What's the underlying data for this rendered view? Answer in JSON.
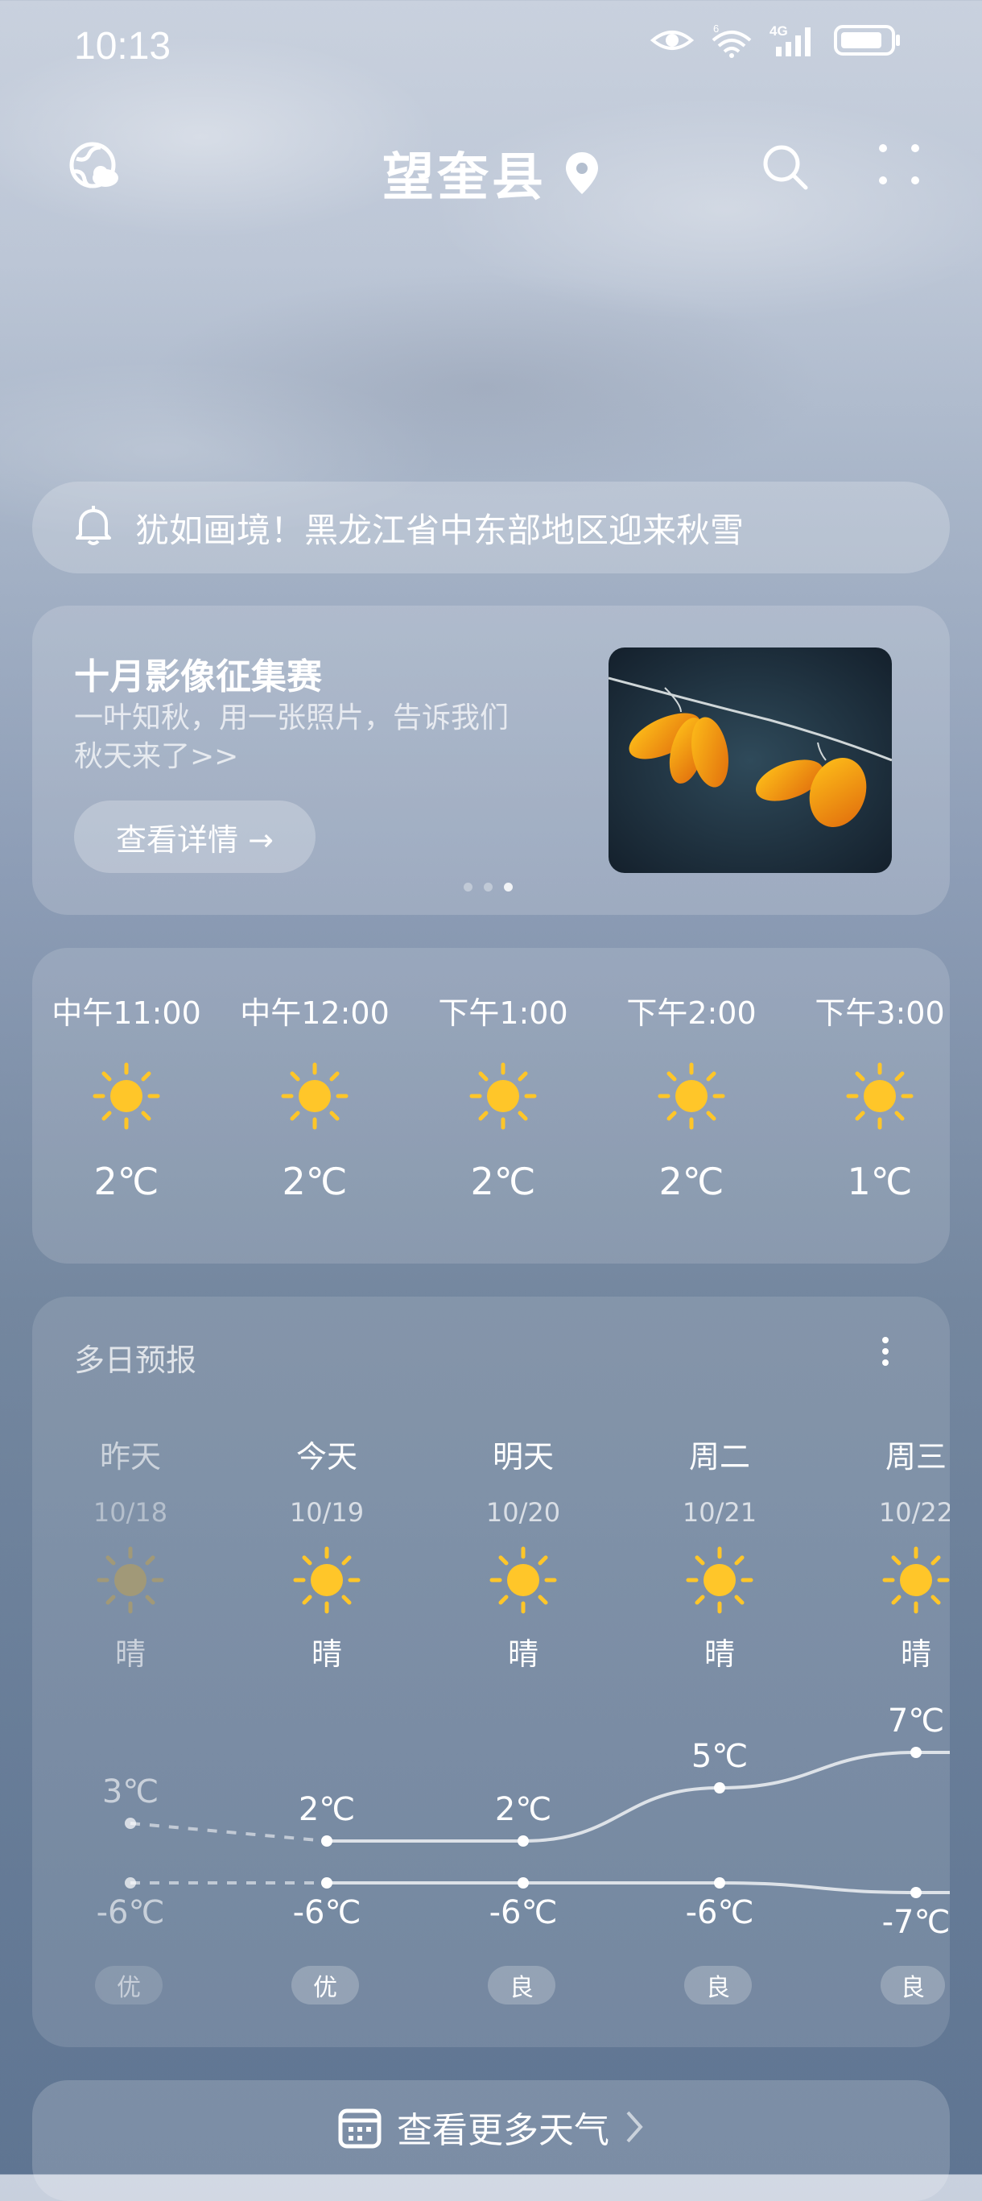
{
  "status_bar": {
    "time": "10:13",
    "network_label": "4G",
    "wifi_label": "6"
  },
  "header": {
    "city": "望奎县"
  },
  "banner": {
    "text": "犹如画境！黑龙江省中东部地区迎来秋雪"
  },
  "promo": {
    "title": "十月影像征集赛",
    "subtitle": "一叶知秋，用一张照片，告诉我们秋天来了>>",
    "button_label": "查看详情 →",
    "page_count": 3,
    "active_page": 3
  },
  "hourly": [
    {
      "time": "中午11:00",
      "icon": "sun-icon",
      "temp": "2℃"
    },
    {
      "time": "中午12:00",
      "icon": "sun-icon",
      "temp": "2℃"
    },
    {
      "time": "下午1:00",
      "icon": "sun-icon",
      "temp": "2℃"
    },
    {
      "time": "下午2:00",
      "icon": "sun-icon",
      "temp": "2℃"
    },
    {
      "time": "下午3:00",
      "icon": "sun-icon",
      "temp": "1℃"
    }
  ],
  "daily": {
    "title": "多日预报",
    "days": [
      {
        "day": "昨天",
        "date": "10/18",
        "condition": "晴",
        "high": "3℃",
        "low": "-6℃",
        "high_value": 3,
        "low_value": -6,
        "aqi": "优",
        "past": true
      },
      {
        "day": "今天",
        "date": "10/19",
        "condition": "晴",
        "high": "2℃",
        "low": "-6℃",
        "high_value": 2,
        "low_value": -6,
        "aqi": "优",
        "past": false
      },
      {
        "day": "明天",
        "date": "10/20",
        "condition": "晴",
        "high": "2℃",
        "low": "-6℃",
        "high_value": 2,
        "low_value": -6,
        "aqi": "良",
        "past": false
      },
      {
        "day": "周二",
        "date": "10/21",
        "condition": "晴",
        "high": "5℃",
        "low": "-6℃",
        "high_value": 5,
        "low_value": -6,
        "aqi": "良",
        "past": false
      },
      {
        "day": "周三",
        "date": "10/22",
        "condition": "晴",
        "high": "7℃",
        "low": "-7℃",
        "high_value": 7,
        "low_value": -7,
        "aqi": "良",
        "past": false
      }
    ]
  },
  "more_weather": {
    "label": "查看更多天气"
  },
  "colors": {
    "sun": "#ffc629",
    "sun_dim": "#b9a05a"
  }
}
